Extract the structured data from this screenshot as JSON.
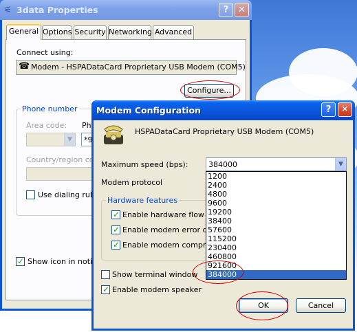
{
  "properties_window": {
    "title": "3data Properties",
    "tabs": [
      "General",
      "Options",
      "Security",
      "Networking",
      "Advanced"
    ],
    "active_tab": "General",
    "connect_using_label": "Connect using:",
    "device_name": "Modem - HSPADataCard Proprietary USB Modem (COM5)",
    "configure_label": "Configure...",
    "phone_group_title": "Phone number",
    "area_code_label": "Area code:",
    "phone_label_partial": "Ph",
    "phone_value_partial": "*9",
    "country_label": "Country/region code",
    "dialing_rules_label": "Use dialing rules",
    "show_icon_label": "Show icon in notific"
  },
  "modem_dialog": {
    "title": "Modem Configuration",
    "device_name": "HSPADataCard Proprietary USB Modem (COM5)",
    "max_speed_label": "Maximum speed (bps):",
    "max_speed_value": "384000",
    "protocol_label": "Modem protocol",
    "hardware_group_title": "Hardware features",
    "hw_flow_label": "Enable hardware flow con",
    "error_ctrl_label": "Enable modem error contr",
    "compression_label": "Enable modem compressio",
    "terminal_label": "Show terminal window",
    "speaker_label": "Enable modem speaker",
    "ok_label": "OK",
    "cancel_label": "Cancel",
    "speed_options": [
      "1200",
      "2400",
      "4800",
      "9600",
      "19200",
      "38400",
      "57600",
      "115200",
      "230400",
      "460800",
      "921600",
      "384000"
    ],
    "selected_speed": "384000"
  },
  "checkboxes": {
    "dialing_rules": false,
    "show_icon": true,
    "hw_flow": true,
    "error_ctrl": true,
    "compression": true,
    "terminal": false,
    "speaker": true
  },
  "colors": {
    "titlebar_active": "#0a55dc",
    "selection": "#316ac5",
    "annotation_red": "#d40000",
    "dialog_face": "#ece9d8"
  }
}
